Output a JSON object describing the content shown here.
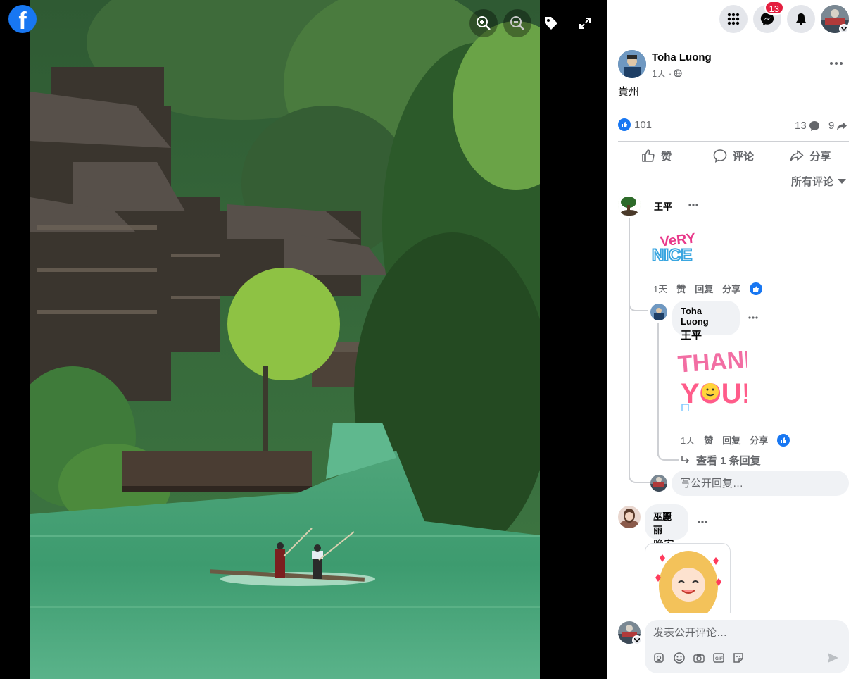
{
  "viewer": {
    "logo_letter": "f",
    "tools": [
      "zoom-in",
      "zoom-out",
      "tag",
      "fullscreen"
    ]
  },
  "topbar": {
    "messenger_badge": "13"
  },
  "post": {
    "author": "Toha Luong",
    "time": "1天 ·",
    "text": "貴州",
    "like_count": "101",
    "comment_count": "13",
    "share_count": "9"
  },
  "actions": {
    "like": "赞",
    "comment": "评论",
    "share": "分享"
  },
  "sort_label": "所有评论",
  "comments": [
    {
      "author": "王平",
      "sticker_text": "Very Nice",
      "time": "1天",
      "like": "赞",
      "reply": "回复",
      "share": "分享",
      "replies": [
        {
          "author": "Toha Luong",
          "mention": "王平",
          "sticker_line1": "THANK",
          "sticker_line2": "YOU!",
          "time": "1天",
          "like": "赞",
          "reply": "回复",
          "share": "分享"
        }
      ],
      "view_more": "查看 1 条回复"
    },
    {
      "author": "巫麗丽",
      "text": "晚安"
    }
  ],
  "reply_placeholder": "写公开回复…",
  "composer_placeholder": "发表公开评论…",
  "colors": {
    "brand": "#1877f2",
    "badge": "#e41e3f",
    "secondary_text": "#65676b"
  }
}
